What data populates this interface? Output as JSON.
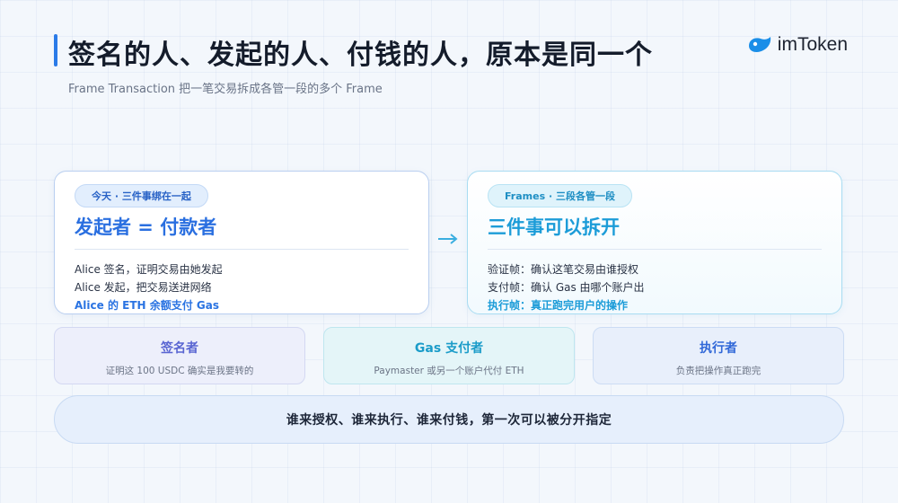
{
  "header": {
    "title": "签名的人、发起的人、付钱的人，原本是同一个",
    "subtitle": "Frame Transaction 把一笔交易拆成各管一段的多个 Frame"
  },
  "brand": {
    "name": "imToken",
    "color": "#1a8ee8"
  },
  "left_card": {
    "tag": "今天 · 三件事绑在一起",
    "heading": "发起者 = 付款者",
    "lines": [
      "Alice 签名，证明交易由她发起",
      "Alice 发起，把交易送进网络",
      "Alice 的 ETH 余额支付 Gas"
    ]
  },
  "right_card": {
    "tag": "Frames · 三段各管一段",
    "heading": "三件事可以拆开",
    "lines": [
      "验证帧：确认这笔交易由谁授权",
      "支付帧：确认 Gas 由哪个账户出",
      "执行帧：真正跑完用户的操作"
    ]
  },
  "roles": [
    {
      "title": "签名者",
      "desc": "证明这 100 USDC 确实是我要转的"
    },
    {
      "title": "Gas 支付者",
      "desc": "Paymaster 或另一个账户代付 ETH"
    },
    {
      "title": "执行者",
      "desc": "负责把操作真正跑完"
    }
  ],
  "summary": "谁来授权、谁来执行、谁来付钱，第一次可以被分开指定",
  "colors": {
    "accent": "#2a6fe0",
    "accent_alt": "#1c9cd8"
  }
}
